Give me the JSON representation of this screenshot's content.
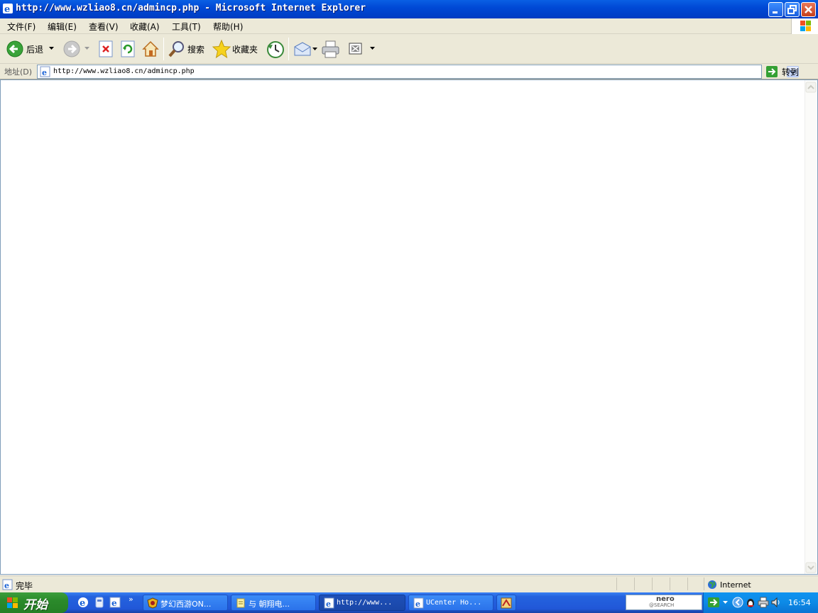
{
  "window": {
    "title": "http://www.wzliao8.cn/admincp.php - Microsoft Internet Explorer"
  },
  "menu": {
    "items": [
      "文件(F)",
      "编辑(E)",
      "查看(V)",
      "收藏(A)",
      "工具(T)",
      "帮助(H)"
    ]
  },
  "toolbar": {
    "back_label": "后退",
    "search_label": "搜索",
    "favorites_label": "收藏夹"
  },
  "address": {
    "label": "地址(D)",
    "url": "http://www.wzliao8.cn/admincp.php",
    "go_label": "转到"
  },
  "status": {
    "text": "完毕",
    "zone": "Internet"
  },
  "taskbar": {
    "start_label": "开始",
    "tasks": [
      "梦幻西游ON...",
      "与 朝翔电...",
      "http://www...",
      "UCenter Ho..."
    ],
    "clock": "16:54",
    "nero_line1": "nero",
    "nero_line2": "@SEARCH"
  },
  "colors": {
    "title_bar": "#0054e3",
    "chrome": "#ece9d8",
    "taskbar": "#2157d8",
    "start": "#2b8a2b",
    "tray": "#0d8ae6"
  }
}
